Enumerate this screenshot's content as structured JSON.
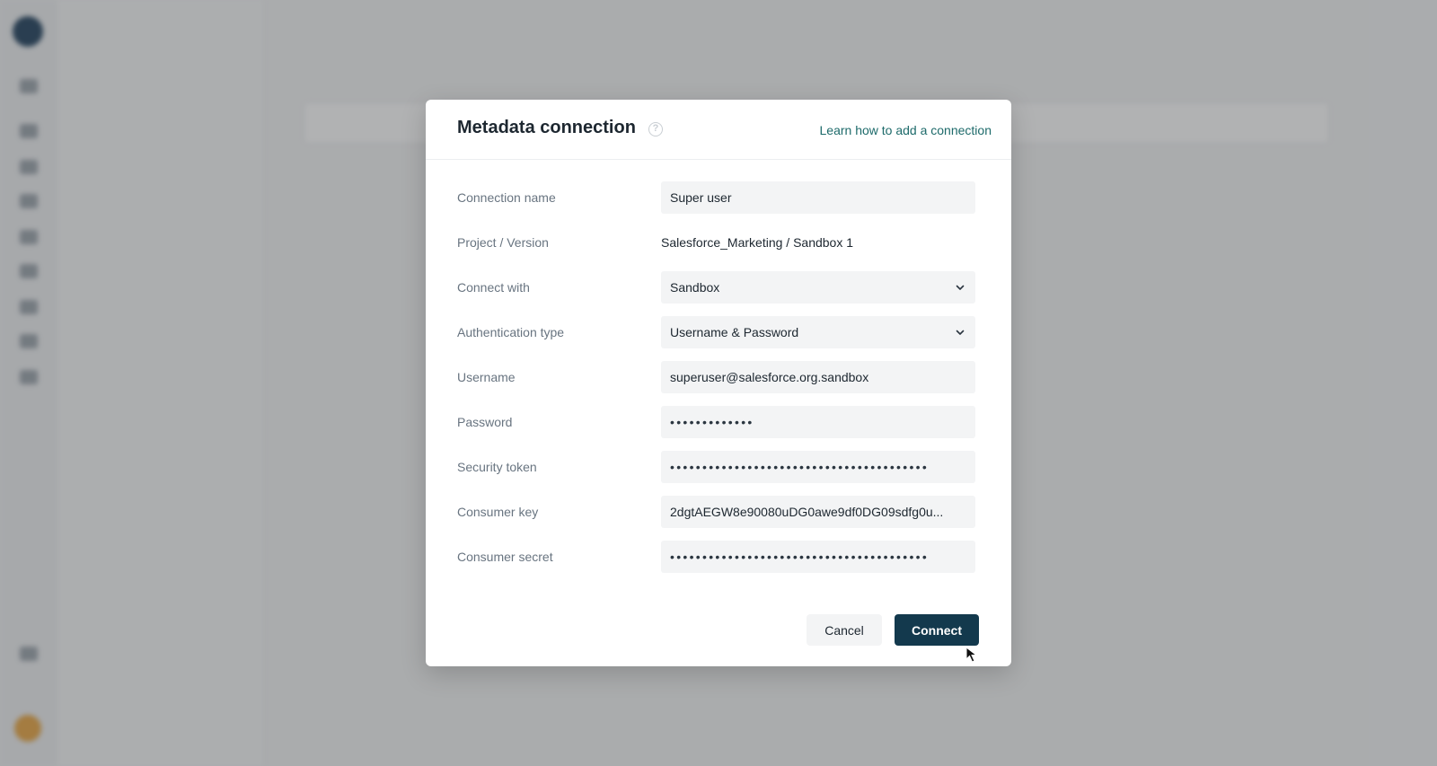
{
  "modal": {
    "title": "Metadata connection",
    "help_icon": "help-circle-icon",
    "learn_link": "Learn how to add a connection",
    "fields": {
      "connection_name": {
        "label": "Connection name",
        "value": "Super user"
      },
      "project_version": {
        "label": "Project / Version",
        "value": "Salesforce_Marketing / Sandbox 1"
      },
      "connect_with": {
        "label": "Connect with",
        "value": "Sandbox"
      },
      "auth_type": {
        "label": "Authentication type",
        "value": "Username & Password"
      },
      "username": {
        "label": "Username",
        "value": "superuser@salesforce.org.sandbox"
      },
      "password": {
        "label": "Password",
        "value": "•••••••••••••"
      },
      "security_token": {
        "label": "Security token",
        "value": "••••••••••••••••••••••••••••••••••••••••"
      },
      "consumer_key": {
        "label": "Consumer key",
        "value": "2dgtAEGW8e90080uDG0awe9df0DG09sdfg0u..."
      },
      "consumer_secret": {
        "label": "Consumer secret",
        "value": "••••••••••••••••••••••••••••••••••••••••"
      }
    },
    "buttons": {
      "cancel": "Cancel",
      "connect": "Connect"
    }
  },
  "colors": {
    "primary_button": "#13394d",
    "link": "#1d6a6a",
    "overlay": "rgba(60,62,66,0.40)"
  }
}
